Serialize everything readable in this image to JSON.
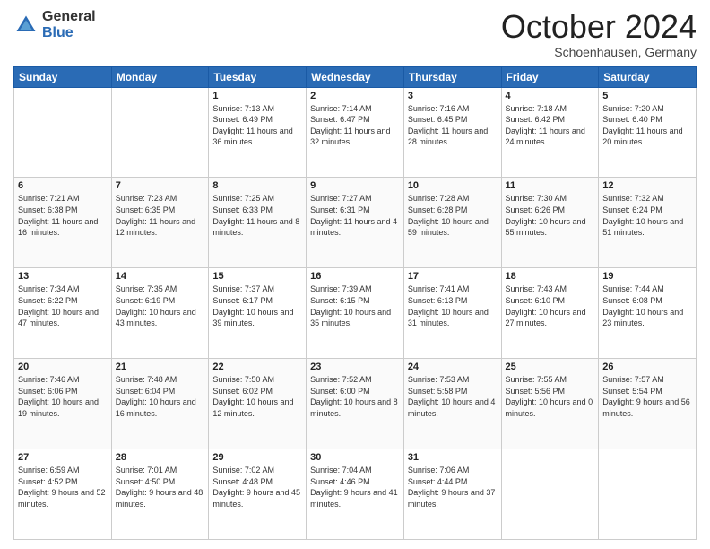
{
  "header": {
    "logo": {
      "general": "General",
      "blue": "Blue"
    },
    "title": "October 2024",
    "location": "Schoenhausen, Germany"
  },
  "days_of_week": [
    "Sunday",
    "Monday",
    "Tuesday",
    "Wednesday",
    "Thursday",
    "Friday",
    "Saturday"
  ],
  "weeks": [
    [
      {
        "day": "",
        "info": ""
      },
      {
        "day": "",
        "info": ""
      },
      {
        "day": "1",
        "sunrise": "Sunrise: 7:13 AM",
        "sunset": "Sunset: 6:49 PM",
        "daylight": "Daylight: 11 hours and 36 minutes."
      },
      {
        "day": "2",
        "sunrise": "Sunrise: 7:14 AM",
        "sunset": "Sunset: 6:47 PM",
        "daylight": "Daylight: 11 hours and 32 minutes."
      },
      {
        "day": "3",
        "sunrise": "Sunrise: 7:16 AM",
        "sunset": "Sunset: 6:45 PM",
        "daylight": "Daylight: 11 hours and 28 minutes."
      },
      {
        "day": "4",
        "sunrise": "Sunrise: 7:18 AM",
        "sunset": "Sunset: 6:42 PM",
        "daylight": "Daylight: 11 hours and 24 minutes."
      },
      {
        "day": "5",
        "sunrise": "Sunrise: 7:20 AM",
        "sunset": "Sunset: 6:40 PM",
        "daylight": "Daylight: 11 hours and 20 minutes."
      }
    ],
    [
      {
        "day": "6",
        "sunrise": "Sunrise: 7:21 AM",
        "sunset": "Sunset: 6:38 PM",
        "daylight": "Daylight: 11 hours and 16 minutes."
      },
      {
        "day": "7",
        "sunrise": "Sunrise: 7:23 AM",
        "sunset": "Sunset: 6:35 PM",
        "daylight": "Daylight: 11 hours and 12 minutes."
      },
      {
        "day": "8",
        "sunrise": "Sunrise: 7:25 AM",
        "sunset": "Sunset: 6:33 PM",
        "daylight": "Daylight: 11 hours and 8 minutes."
      },
      {
        "day": "9",
        "sunrise": "Sunrise: 7:27 AM",
        "sunset": "Sunset: 6:31 PM",
        "daylight": "Daylight: 11 hours and 4 minutes."
      },
      {
        "day": "10",
        "sunrise": "Sunrise: 7:28 AM",
        "sunset": "Sunset: 6:28 PM",
        "daylight": "Daylight: 10 hours and 59 minutes."
      },
      {
        "day": "11",
        "sunrise": "Sunrise: 7:30 AM",
        "sunset": "Sunset: 6:26 PM",
        "daylight": "Daylight: 10 hours and 55 minutes."
      },
      {
        "day": "12",
        "sunrise": "Sunrise: 7:32 AM",
        "sunset": "Sunset: 6:24 PM",
        "daylight": "Daylight: 10 hours and 51 minutes."
      }
    ],
    [
      {
        "day": "13",
        "sunrise": "Sunrise: 7:34 AM",
        "sunset": "Sunset: 6:22 PM",
        "daylight": "Daylight: 10 hours and 47 minutes."
      },
      {
        "day": "14",
        "sunrise": "Sunrise: 7:35 AM",
        "sunset": "Sunset: 6:19 PM",
        "daylight": "Daylight: 10 hours and 43 minutes."
      },
      {
        "day": "15",
        "sunrise": "Sunrise: 7:37 AM",
        "sunset": "Sunset: 6:17 PM",
        "daylight": "Daylight: 10 hours and 39 minutes."
      },
      {
        "day": "16",
        "sunrise": "Sunrise: 7:39 AM",
        "sunset": "Sunset: 6:15 PM",
        "daylight": "Daylight: 10 hours and 35 minutes."
      },
      {
        "day": "17",
        "sunrise": "Sunrise: 7:41 AM",
        "sunset": "Sunset: 6:13 PM",
        "daylight": "Daylight: 10 hours and 31 minutes."
      },
      {
        "day": "18",
        "sunrise": "Sunrise: 7:43 AM",
        "sunset": "Sunset: 6:10 PM",
        "daylight": "Daylight: 10 hours and 27 minutes."
      },
      {
        "day": "19",
        "sunrise": "Sunrise: 7:44 AM",
        "sunset": "Sunset: 6:08 PM",
        "daylight": "Daylight: 10 hours and 23 minutes."
      }
    ],
    [
      {
        "day": "20",
        "sunrise": "Sunrise: 7:46 AM",
        "sunset": "Sunset: 6:06 PM",
        "daylight": "Daylight: 10 hours and 19 minutes."
      },
      {
        "day": "21",
        "sunrise": "Sunrise: 7:48 AM",
        "sunset": "Sunset: 6:04 PM",
        "daylight": "Daylight: 10 hours and 16 minutes."
      },
      {
        "day": "22",
        "sunrise": "Sunrise: 7:50 AM",
        "sunset": "Sunset: 6:02 PM",
        "daylight": "Daylight: 10 hours and 12 minutes."
      },
      {
        "day": "23",
        "sunrise": "Sunrise: 7:52 AM",
        "sunset": "Sunset: 6:00 PM",
        "daylight": "Daylight: 10 hours and 8 minutes."
      },
      {
        "day": "24",
        "sunrise": "Sunrise: 7:53 AM",
        "sunset": "Sunset: 5:58 PM",
        "daylight": "Daylight: 10 hours and 4 minutes."
      },
      {
        "day": "25",
        "sunrise": "Sunrise: 7:55 AM",
        "sunset": "Sunset: 5:56 PM",
        "daylight": "Daylight: 10 hours and 0 minutes."
      },
      {
        "day": "26",
        "sunrise": "Sunrise: 7:57 AM",
        "sunset": "Sunset: 5:54 PM",
        "daylight": "Daylight: 9 hours and 56 minutes."
      }
    ],
    [
      {
        "day": "27",
        "sunrise": "Sunrise: 6:59 AM",
        "sunset": "Sunset: 4:52 PM",
        "daylight": "Daylight: 9 hours and 52 minutes."
      },
      {
        "day": "28",
        "sunrise": "Sunrise: 7:01 AM",
        "sunset": "Sunset: 4:50 PM",
        "daylight": "Daylight: 9 hours and 48 minutes."
      },
      {
        "day": "29",
        "sunrise": "Sunrise: 7:02 AM",
        "sunset": "Sunset: 4:48 PM",
        "daylight": "Daylight: 9 hours and 45 minutes."
      },
      {
        "day": "30",
        "sunrise": "Sunrise: 7:04 AM",
        "sunset": "Sunset: 4:46 PM",
        "daylight": "Daylight: 9 hours and 41 minutes."
      },
      {
        "day": "31",
        "sunrise": "Sunrise: 7:06 AM",
        "sunset": "Sunset: 4:44 PM",
        "daylight": "Daylight: 9 hours and 37 minutes."
      },
      {
        "day": "",
        "info": ""
      },
      {
        "day": "",
        "info": ""
      }
    ]
  ]
}
